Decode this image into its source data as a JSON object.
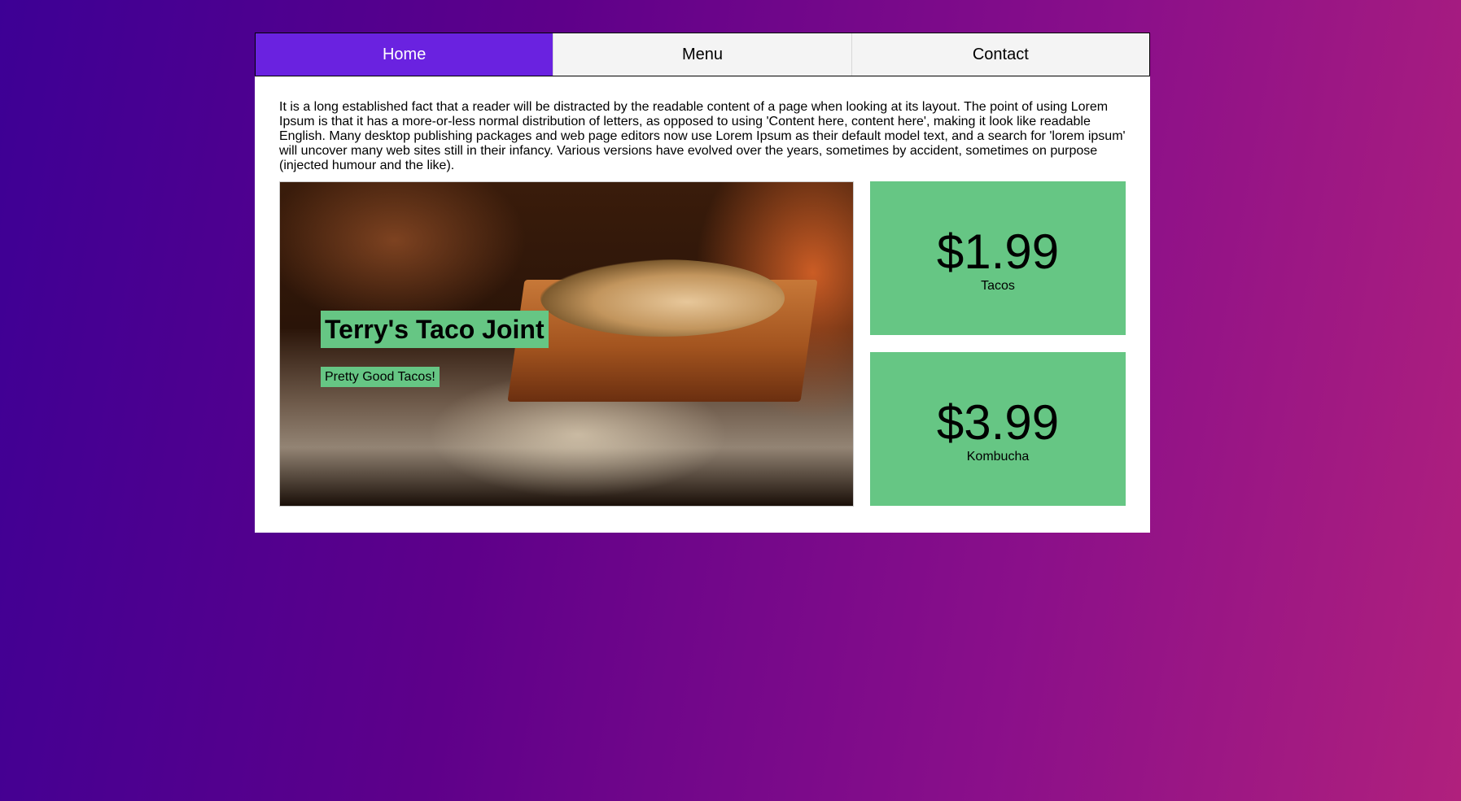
{
  "nav": {
    "items": [
      {
        "label": "Home",
        "active": true
      },
      {
        "label": "Menu",
        "active": false
      },
      {
        "label": "Contact",
        "active": false
      }
    ]
  },
  "intro_text": "It is a long established fact that a reader will be distracted by the readable content of a page when looking at its layout. The point of using Lorem Ipsum is that it has a more-or-less normal distribution of letters, as opposed to using 'Content here, content here', making it look like readable English. Many desktop publishing packages and web page editors now use Lorem Ipsum as their default model text, and a search for 'lorem ipsum' will uncover many web sites still in their infancy. Various versions have evolved over the years, sometimes by accident, sometimes on purpose (injected humour and the like).",
  "hero": {
    "title": "Terry's Taco Joint",
    "subtitle": "Pretty Good Tacos!"
  },
  "prices": [
    {
      "price": "$1.99",
      "item": "Tacos"
    },
    {
      "price": "$3.99",
      "item": "Kombucha"
    }
  ],
  "colors": {
    "nav_active": "#6a22e0",
    "accent_green": "#66c684"
  }
}
